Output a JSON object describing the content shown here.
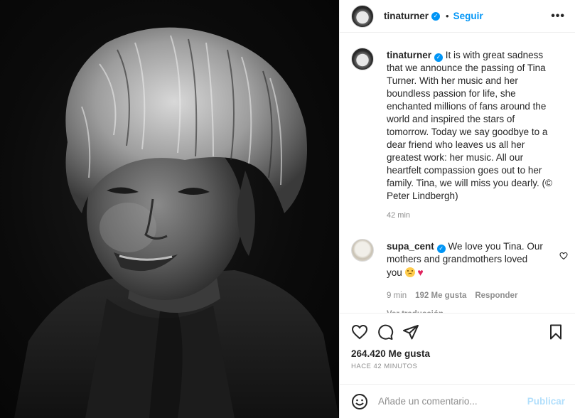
{
  "post": {
    "author": "tinaturner",
    "follow_label": "Seguir",
    "more_label": "•••",
    "caption_author": "tinaturner",
    "caption_text": "It is with great sadness that we announce the passing of Tina Turner. With her music and her boundless passion for life, she enchanted millions of fans around the world and inspired the stars of tomorrow. Today we say goodbye to a dear friend who leaves us all her greatest work: her music. All our heartfelt compassion goes out to her family. Tina, we will miss you dearly. (© Peter Lindbergh)",
    "caption_time": "42 min",
    "verified_icon": "verified-badge-icon"
  },
  "comments": [
    {
      "author": "supa_cent",
      "text": "We love you Tina. Our mothers and grandmothers loved you",
      "time": "9 min",
      "likes": "192 Me gusta",
      "reply_label": "Responder",
      "translate_label": "Ver traducción"
    }
  ],
  "footer": {
    "likes": "264.420 Me gusta",
    "ago": "HACE 42 MINUTOS",
    "comment_placeholder": "Añade un comentario...",
    "publish_label": "Publicar"
  },
  "colors": {
    "accent": "#0095f6",
    "publish_disabled": "#b2dffc",
    "muted": "#8e8e8e",
    "text": "#262626",
    "border": "#efefef"
  }
}
